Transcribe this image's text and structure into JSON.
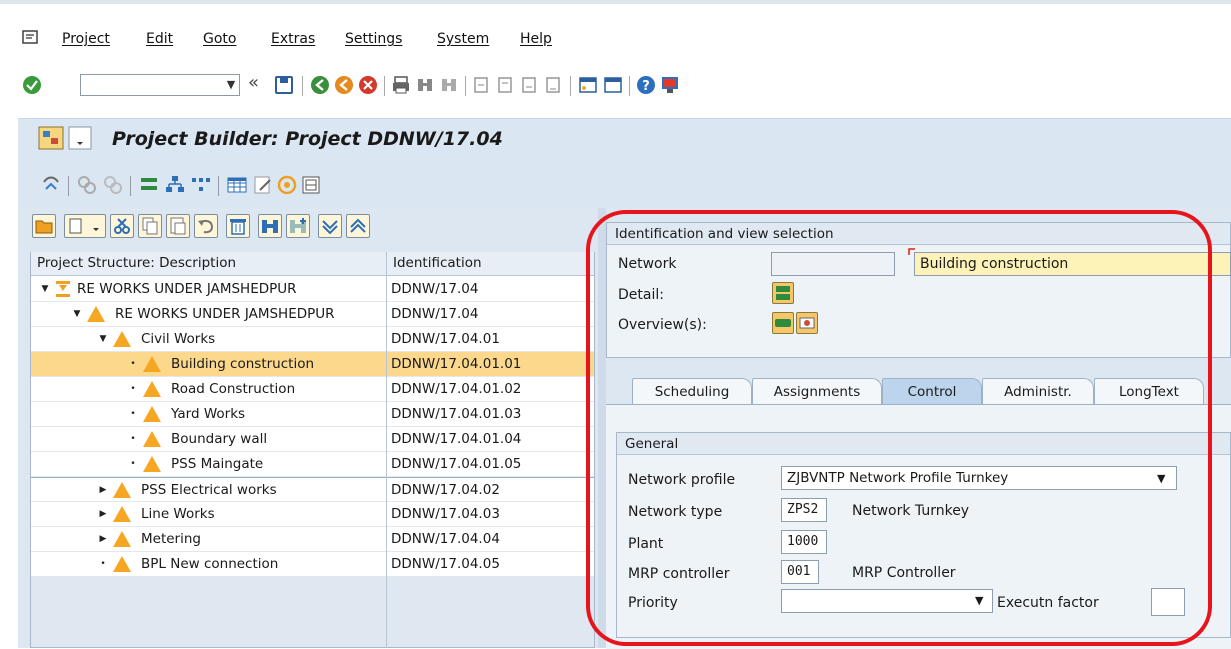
{
  "menu": {
    "items": [
      "Project",
      "Edit",
      "Goto",
      "Extras",
      "Settings",
      "System",
      "Help"
    ]
  },
  "toolbar": {
    "command_value": "",
    "back_glyph": "«"
  },
  "title": "Project Builder: Project DDNW/17.04",
  "tree": {
    "col_description": "Project Structure: Description",
    "col_identification": "Identification",
    "rows": [
      {
        "description": "RE WORKS UNDER JAMSHEDPUR",
        "id": "DDNW/17.04",
        "level": 0,
        "expander": "▼",
        "icon": "project-icon"
      },
      {
        "description": "RE WORKS UNDER JAMSHEDPUR",
        "id": "DDNW/17.04",
        "level": 1,
        "expander": "▼",
        "icon": "warning-icon"
      },
      {
        "description": "Civil Works",
        "id": "DDNW/17.04.01",
        "level": 2,
        "expander": "▼",
        "icon": "warning-icon"
      },
      {
        "description": "Building construction",
        "id": "DDNW/17.04.01.01",
        "level": 3,
        "expander": "•",
        "icon": "warning-icon",
        "selected": true
      },
      {
        "description": "Road Construction",
        "id": "DDNW/17.04.01.02",
        "level": 3,
        "expander": "•",
        "icon": "warning-icon"
      },
      {
        "description": "Yard Works",
        "id": "DDNW/17.04.01.03",
        "level": 3,
        "expander": "•",
        "icon": "warning-icon"
      },
      {
        "description": "Boundary wall",
        "id": "DDNW/17.04.01.04",
        "level": 3,
        "expander": "•",
        "icon": "warning-icon"
      },
      {
        "description": "PSS Maingate",
        "id": "DDNW/17.04.01.05",
        "level": 3,
        "expander": "•",
        "icon": "warning-icon"
      },
      {
        "description": "PSS Electrical works",
        "id": "DDNW/17.04.02",
        "level": 2,
        "expander": "▶",
        "icon": "warning-icon"
      },
      {
        "description": "Line Works",
        "id": "DDNW/17.04.03",
        "level": 2,
        "expander": "▶",
        "icon": "warning-icon"
      },
      {
        "description": "Metering",
        "id": "DDNW/17.04.04",
        "level": 2,
        "expander": "▶",
        "icon": "warning-icon"
      },
      {
        "description": "BPL New connection",
        "id": "DDNW/17.04.05",
        "level": 2,
        "expander": "•",
        "icon": "warning-icon"
      }
    ]
  },
  "ident": {
    "group_title": "Identification and view selection",
    "network_label": "Network",
    "network_value": "",
    "network_desc": "Building construction",
    "detail_label": "Detail:",
    "overview_label": "Overview(s):"
  },
  "tabs": [
    {
      "label": "Scheduling",
      "active": false
    },
    {
      "label": "Assignments",
      "active": false
    },
    {
      "label": "Control",
      "active": true
    },
    {
      "label": "Administr.",
      "active": false
    },
    {
      "label": "LongText",
      "active": false
    }
  ],
  "general": {
    "group_title": "General",
    "network_profile_label": "Network profile",
    "network_profile_value": "ZJBVNTP Network Profile Turnkey",
    "network_type_label": "Network type",
    "network_type_value": "ZPS2",
    "network_type_desc": "Network Turnkey",
    "plant_label": "Plant",
    "plant_value": "1000",
    "mrp_label": "MRP controller",
    "mrp_value": "001",
    "mrp_desc": "MRP Controller",
    "priority_label": "Priority",
    "priority_value": "",
    "exec_factor_label": "Executn factor",
    "exec_factor_value": ""
  },
  "colors": {
    "accent": "#dae6f2",
    "selection": "#fcd88c",
    "warning": "#f5a623",
    "annotation": "#e8141b"
  }
}
